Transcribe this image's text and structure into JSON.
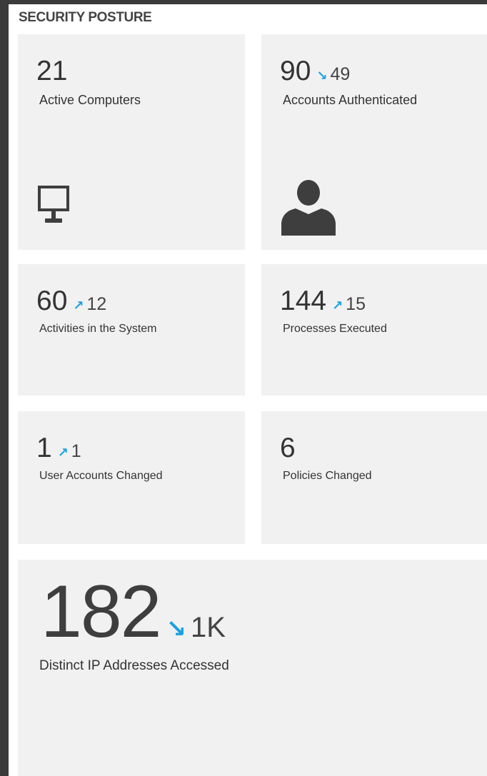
{
  "section_title": "SECURITY POSTURE",
  "colors": {
    "background_dark": "#3b3b3b",
    "panel": "#ffffff",
    "tile": "#f1f1f1",
    "accent_arrow": "#1aa1e3",
    "text": "#333333"
  },
  "tiles": [
    {
      "value": "21",
      "label": "Active Computers",
      "trend": null,
      "delta": null,
      "icon": "monitor-icon"
    },
    {
      "value": "90",
      "label": "Accounts Authenticated",
      "trend": "down",
      "delta": "49",
      "icon": "user-icon"
    },
    {
      "value": "60",
      "label": "Activities in the System",
      "trend": "up",
      "delta": "12",
      "icon": null
    },
    {
      "value": "144",
      "label": "Processes Executed",
      "trend": "up",
      "delta": "15",
      "icon": null
    },
    {
      "value": "1",
      "label": "User Accounts Changed",
      "trend": "up",
      "delta": "1",
      "icon": null
    },
    {
      "value": "6",
      "label": "Policies Changed",
      "trend": null,
      "delta": null,
      "icon": null
    },
    {
      "value": "182",
      "label": "Distinct IP Addresses Accessed",
      "trend": "down",
      "delta": "1K",
      "icon": null
    }
  ]
}
